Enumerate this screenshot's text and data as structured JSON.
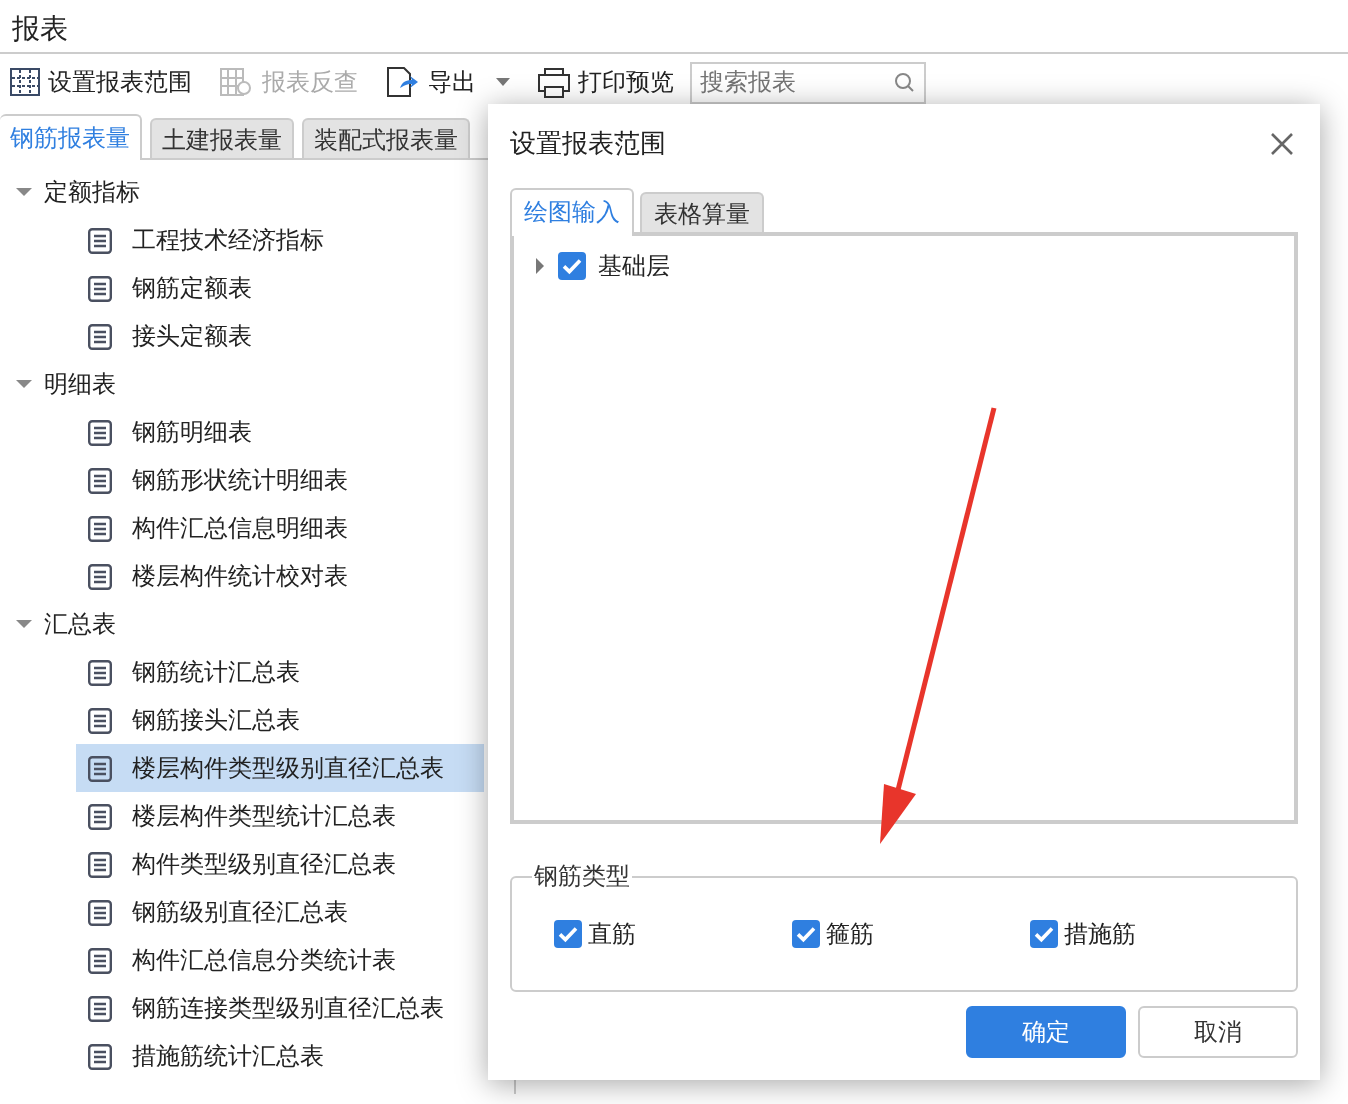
{
  "window": {
    "title": "报表"
  },
  "toolbar": [
    {
      "label": "设置报表范围",
      "kind": "grid",
      "disabled": false
    },
    {
      "label": "报表反查",
      "kind": "grid-search",
      "disabled": true
    },
    {
      "label": "导出",
      "kind": "export",
      "disabled": false,
      "dropdown": true
    },
    {
      "label": "打印预览",
      "kind": "print",
      "disabled": false,
      "dropdown": false
    }
  ],
  "search": {
    "placeholder": "搜索报表"
  },
  "report_tabs": [
    {
      "label": "钢筋报表量",
      "selected": true
    },
    {
      "label": "土建报表量",
      "selected": false
    },
    {
      "label": "装配式报表量",
      "selected": false
    }
  ],
  "report_tree": [
    {
      "label": "定额指标",
      "expanded": true,
      "children": [
        {
          "label": "工程技术经济指标",
          "selected": false
        },
        {
          "label": "钢筋定额表",
          "selected": false
        },
        {
          "label": "接头定额表",
          "selected": false
        }
      ]
    },
    {
      "label": "明细表",
      "expanded": true,
      "children": [
        {
          "label": "钢筋明细表",
          "selected": false
        },
        {
          "label": "钢筋形状统计明细表",
          "selected": false
        },
        {
          "label": "构件汇总信息明细表",
          "selected": false
        },
        {
          "label": "楼层构件统计校对表",
          "selected": false
        }
      ]
    },
    {
      "label": "汇总表",
      "expanded": true,
      "children": [
        {
          "label": "钢筋统计汇总表",
          "selected": false
        },
        {
          "label": "钢筋接头汇总表",
          "selected": false
        },
        {
          "label": "楼层构件类型级别直径汇总表",
          "selected": true
        },
        {
          "label": "楼层构件类型统计汇总表",
          "selected": false
        },
        {
          "label": "构件类型级别直径汇总表",
          "selected": false
        },
        {
          "label": "钢筋级别直径汇总表",
          "selected": false
        },
        {
          "label": "构件汇总信息分类统计表",
          "selected": false
        },
        {
          "label": "钢筋连接类型级别直径汇总表",
          "selected": false
        },
        {
          "label": "措施筋统计汇总表",
          "selected": false
        }
      ]
    }
  ],
  "dialog": {
    "title": "设置报表范围",
    "tabs": [
      {
        "label": "绘图输入",
        "selected": true
      },
      {
        "label": "表格算量",
        "selected": false
      }
    ],
    "floors": [
      {
        "label": "基础层",
        "checked": true,
        "expanded": false
      }
    ],
    "rebar_group": {
      "title": "钢筋类型",
      "options": [
        {
          "label": "直筋",
          "checked": true
        },
        {
          "label": "箍筋",
          "checked": true
        },
        {
          "label": "措施筋",
          "checked": true
        }
      ]
    },
    "buttons": [
      {
        "label": "确定",
        "kind": "primary"
      },
      {
        "label": "取消",
        "kind": "secondary"
      }
    ]
  },
  "annotation": {
    "kind": "arrow"
  }
}
